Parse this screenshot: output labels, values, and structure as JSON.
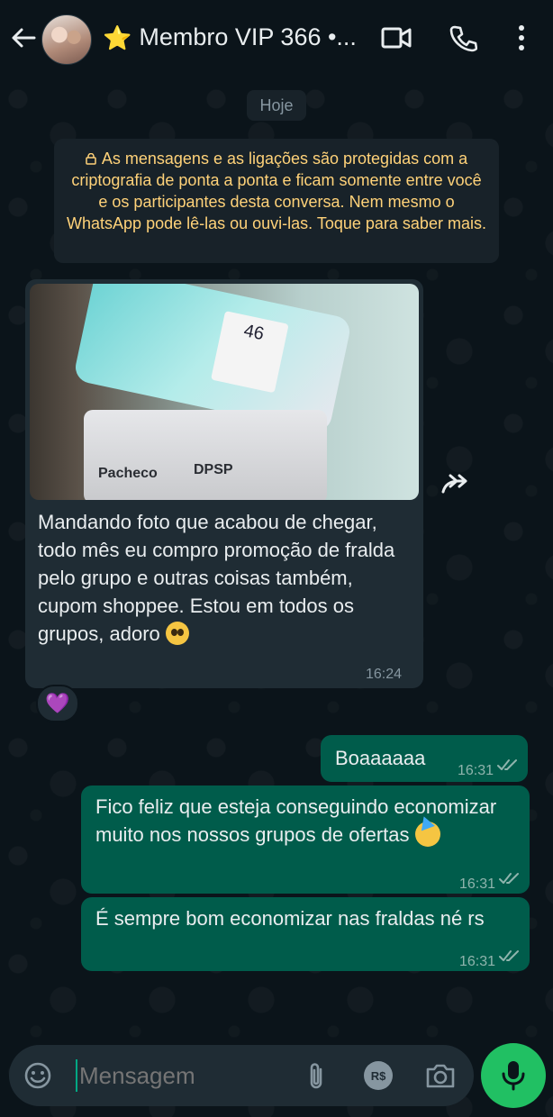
{
  "header": {
    "title_star": "⭐",
    "title": "Membro VIP 366 •...",
    "icons": [
      "back-arrow-icon",
      "avatar",
      "video-call-icon",
      "voice-call-icon",
      "more-options-icon"
    ]
  },
  "chat": {
    "date_label": "Hoje",
    "encryption_notice": "As mensagens e as ligações são protegidas com a criptografia de ponta a ponta e ficam somente entre você e os participantes desta conversa. Nem mesmo o WhatsApp pode lê-las ou ouvi-las. Toque para saber mais.",
    "messages": [
      {
        "direction": "incoming",
        "type": "image",
        "image_text": {
          "label_number": "46",
          "brand_left": "Pacheco",
          "brand_right": "DPSP"
        },
        "caption": "Mandando foto que acabou de chegar, todo mês eu compro promoção de fralda pelo grupo e outras coisas também, cupom shoppee. Estou em todos os grupos, adoro",
        "caption_emoji": "🥹",
        "time": "16:24",
        "reaction": "💜"
      },
      {
        "direction": "outgoing",
        "text": "Boaaaaaa",
        "time": "16:31",
        "status": "read"
      },
      {
        "direction": "outgoing",
        "text": "Fico feliz que esteja conseguindo economizar muito nos nossos grupos de ofertas",
        "emoji": "🥳",
        "time": "16:31",
        "status": "read"
      },
      {
        "direction": "outgoing",
        "text": "É sempre bom economizar nas fraldas né rs",
        "time": "16:31",
        "status": "read"
      }
    ]
  },
  "composer": {
    "placeholder": "Mensagem",
    "icons": [
      "emoji-icon",
      "attach-icon",
      "payment-icon",
      "camera-icon",
      "mic-icon"
    ],
    "payment_label": "R$"
  },
  "colors": {
    "background": "#0b141a",
    "incoming_bubble": "#1f2c34",
    "outgoing_bubble": "#005c4b",
    "notice_text": "#ffd279",
    "accent": "#21c063"
  }
}
